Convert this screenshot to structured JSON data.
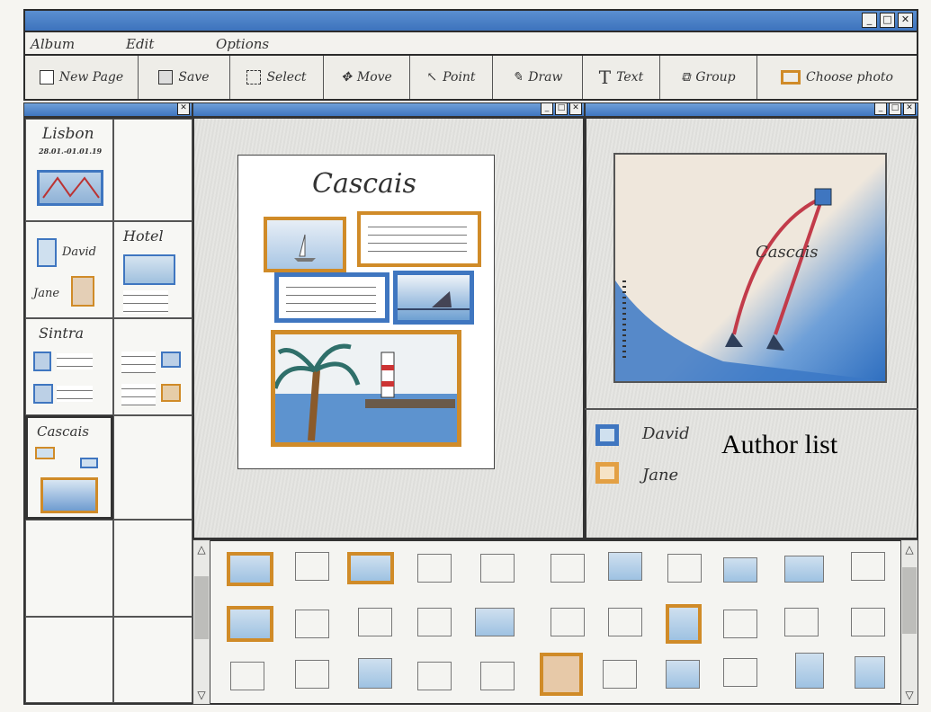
{
  "menu": [
    "Album",
    "Edit",
    "Options"
  ],
  "toolbar": [
    "New Page",
    "Save",
    "Select",
    "Move",
    "Point",
    "Draw",
    "Text",
    "Group",
    "Choose photo"
  ],
  "pages": [
    {
      "title": "Lisbon",
      "date": "28.01.-01.01.19"
    },
    {
      "title": "Hotel"
    },
    {
      "title": "Sintra"
    },
    {
      "title": "Cascais"
    }
  ],
  "people": [
    "David",
    "Jane"
  ],
  "canvas_page_title": "Cascais",
  "map_label": "Cascais",
  "authors": {
    "label": "Author list",
    "items": [
      {
        "name": "David",
        "color": "#3f7fd0"
      },
      {
        "name": "Jane",
        "color": "#e3a044"
      }
    ]
  },
  "accent": {
    "blue": "#3f76c0",
    "orange": "#d89434"
  }
}
